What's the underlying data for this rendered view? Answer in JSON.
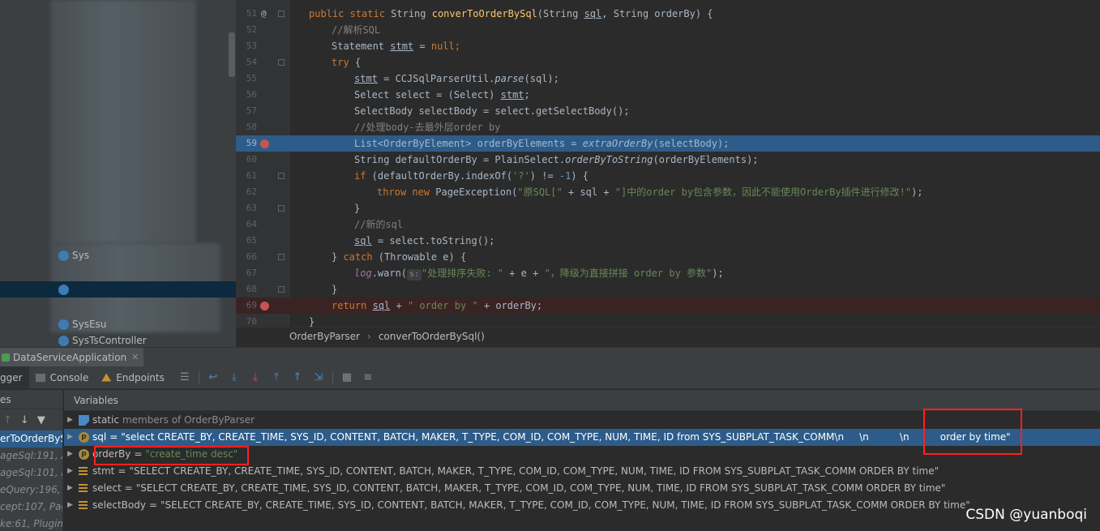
{
  "project_tree": {
    "items": [
      {
        "label": "Sys"
      },
      {
        "label": ""
      },
      {
        "label": ""
      },
      {
        "label": "SysEsu"
      },
      {
        "label": "SysTsController"
      }
    ]
  },
  "editor": {
    "lines": [
      {
        "num": "51"
      },
      {
        "num": "52"
      },
      {
        "num": "53"
      },
      {
        "num": "54"
      },
      {
        "num": "55"
      },
      {
        "num": "56"
      },
      {
        "num": "57"
      },
      {
        "num": "58"
      },
      {
        "num": "59"
      },
      {
        "num": "60"
      },
      {
        "num": "61"
      },
      {
        "num": "62"
      },
      {
        "num": "63"
      },
      {
        "num": "64"
      },
      {
        "num": "65"
      },
      {
        "num": "66"
      },
      {
        "num": "67"
      },
      {
        "num": "68"
      },
      {
        "num": "69"
      },
      {
        "num": "70"
      }
    ],
    "override_mark": "@",
    "code": {
      "l51_a": "public static ",
      "l51_b": "String ",
      "l51_c": "converToOrderBySql",
      "l51_d": "(String ",
      "l51_e": "sql",
      "l51_f": ", String orderBy) {",
      "l52": "//解析SQL",
      "l53_a": "Statement ",
      "l53_b": "stmt",
      "l53_c": " = ",
      "l53_d": "null",
      "l53_e": ";",
      "l54_a": "try",
      "l54_b": " {",
      "l55_a": "stmt",
      "l55_b": " = CCJSqlParserUtil.",
      "l55_c": "parse",
      "l55_d": "(sql);",
      "l56_a": "Select select = (Select) ",
      "l56_b": "stmt",
      "l56_c": ";",
      "l57": "SelectBody selectBody = select.getSelectBody();",
      "l58": "//处理body-去最外层order by",
      "l59_a": "List<OrderByElement> orderByElements = ",
      "l59_b": "extraOrderBy",
      "l59_c": "(selectBody);",
      "l60_a": "String defaultOrderBy = PlainSelect.",
      "l60_b": "orderByToString",
      "l60_c": "(orderByElements);",
      "l61_a": "if",
      "l61_b": " (defaultOrderBy.indexOf(",
      "l61_c": "'?'",
      "l61_d": ") != ",
      "l61_e": "-1",
      "l61_f": ") {",
      "l62_a": "throw new ",
      "l62_b": "PageException(",
      "l62_c": "\"原SQL[\"",
      "l62_d": " + sql + ",
      "l62_e": "\"]中的order by包含参数，因此不能使用OrderBy插件进行修改!\"",
      "l62_f": ");",
      "l63": "}",
      "l64": "//新的sql",
      "l65_a": "sql",
      "l65_b": " = select.toString();",
      "l66_a": "} ",
      "l66_b": "catch",
      "l66_c": " (Throwable e) {",
      "l67_a": "log",
      "l67_b": ".warn(",
      "l67_hint": "s:",
      "l67_c": "\"处理排序失败: \"",
      "l67_d": " + e + ",
      "l67_e": "\"，降级为直接拼接 order by 参数\"",
      "l67_f": ");",
      "l68": "}",
      "l69_a": "return ",
      "l69_b": "sql",
      "l69_c": " + ",
      "l69_d": "\" order by \"",
      "l69_e": " + orderBy;",
      "l70": "}"
    }
  },
  "breadcrumb": {
    "class": "OrderByParser",
    "method": "converToOrderBySql()"
  },
  "debug": {
    "session_tab": "DataServiceApplication",
    "tabs": {
      "debugger": "gger",
      "console": "Console",
      "endpoints": "Endpoints"
    },
    "frames_header": "es",
    "frames": [
      "erToOrderBySq",
      "ageSql:191, A",
      "ageSql:101, P",
      "eQuery:196, E",
      "cept:107, Pag",
      "ke:61, Plugin"
    ],
    "variables_header": "Variables",
    "variables": [
      {
        "kind": "static",
        "name": "static",
        "value": "members of OrderByParser"
      },
      {
        "kind": "p",
        "name": "sql",
        "value": "\"select CREATE_BY, CREATE_TIME, SYS_ID, CONTENT, BATCH, MAKER, T_TYPE, COM_ID, COM_TYPE, NUM, TIME, ID from SYS_SUBPLAT_TASK_COMM\\n     \\n          \\n          order by time\""
      },
      {
        "kind": "p",
        "name": "orderBy",
        "value": "\"create_time desc\""
      },
      {
        "kind": "f",
        "name": "stmt",
        "value": "\"SELECT CREATE_BY, CREATE_TIME, SYS_ID, CONTENT, BATCH, MAKER, T_TYPE, COM_ID, COM_TYPE, NUM, TIME, ID FROM SYS_SUBPLAT_TASK_COMM ORDER BY time\""
      },
      {
        "kind": "f",
        "name": "select",
        "value": "\"SELECT CREATE_BY, CREATE_TIME, SYS_ID, CONTENT, BATCH, MAKER, T_TYPE, COM_ID, COM_TYPE, NUM, TIME, ID FROM SYS_SUBPLAT_TASK_COMM ORDER BY time\""
      },
      {
        "kind": "f",
        "name": "selectBody",
        "value": "\"SELECT CREATE_BY, CREATE_TIME, SYS_ID, CONTENT, BATCH, MAKER, T_TYPE, COM_ID, COM_TYPE, NUM, TIME, ID FROM SYS_SUBPLAT_TASK_COMM ORDER BY time\""
      }
    ]
  },
  "watermark": "CSDN @yuanboqi",
  "colors": {
    "keyword": "#cc7832",
    "method": "#ffc66d",
    "comment": "#808080",
    "string": "#6a8759",
    "selection": "#2d5c8a",
    "annotation_box": "#ff2020"
  }
}
